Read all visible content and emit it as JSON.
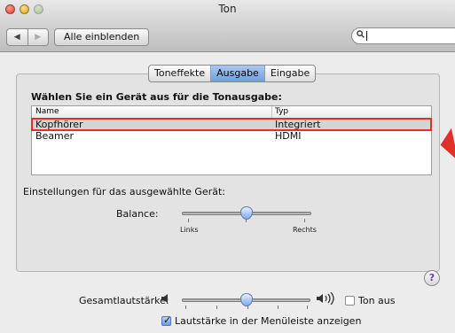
{
  "window": {
    "title": "Ton"
  },
  "toolbar": {
    "back": "◀",
    "forward": "▶",
    "show_all": "Alle einblenden",
    "search_icon": "search-icon"
  },
  "tabs": [
    {
      "label": "Toneffekte",
      "active": false
    },
    {
      "label": "Ausgabe",
      "active": true
    },
    {
      "label": "Eingabe",
      "active": false
    }
  ],
  "output": {
    "heading": "Wählen Sie ein Gerät aus für die Tonausgabe:",
    "columns": {
      "name": "Name",
      "type": "Typ"
    },
    "devices": [
      {
        "name": "Kopfhörer",
        "type": "Integriert",
        "selected": true
      },
      {
        "name": "Beamer",
        "type": "HDMI",
        "selected": false
      }
    ],
    "settings_label": "Einstellungen für das ausgewählte Gerät:",
    "balance": {
      "label": "Balance:",
      "left": "Links",
      "right": "Rechts",
      "value": 0.5
    }
  },
  "help_label": "?",
  "volume": {
    "label": "Gesamtlautstärke:",
    "value": 0.5,
    "mute_label": "Ton aus",
    "mute_checked": false,
    "menubar_label": "Lautstärke in der Menüleiste anzeigen",
    "menubar_checked": true
  },
  "colors": {
    "highlight": "#e0302a",
    "tab_active": "#6f9fdc"
  }
}
